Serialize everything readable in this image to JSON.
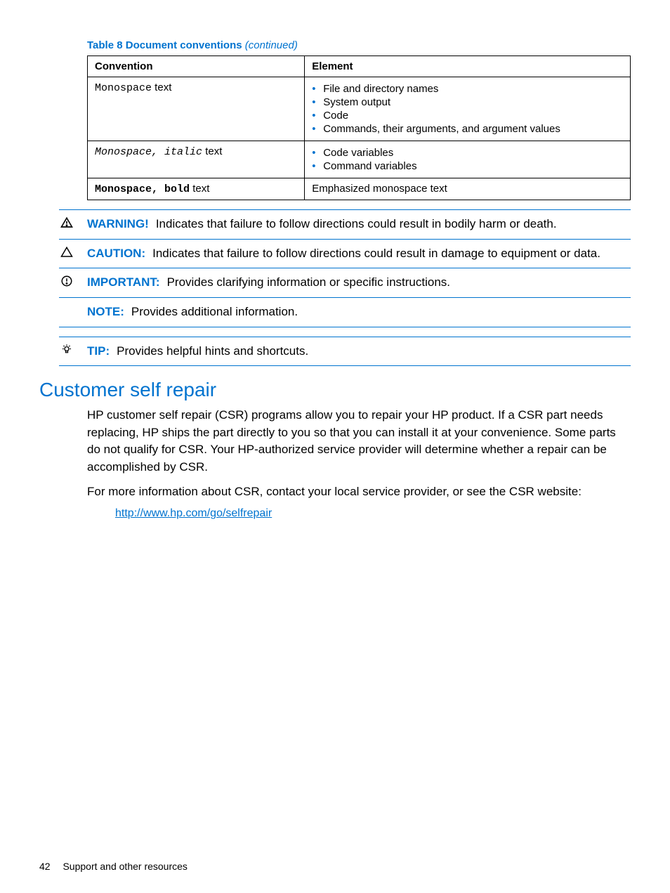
{
  "table": {
    "caption_strong": "Table 8 Document conventions",
    "caption_cont": "(continued)",
    "head_conv": "Convention",
    "head_elem": "Element",
    "rows": [
      {
        "conv_mono": "Monospace",
        "conv_plain": " text",
        "elems": [
          "File and directory names",
          "System output",
          "Code",
          "Commands, their arguments, and argument values"
        ]
      },
      {
        "conv_monoital": "Monospace, italic",
        "conv_plain": " text",
        "elems": [
          "Code variables",
          "Command variables"
        ]
      },
      {
        "conv_monobold": "Monospace, bold",
        "conv_plain": " text",
        "elem_text": "Emphasized monospace text"
      }
    ]
  },
  "admons": {
    "warning": {
      "label": "WARNING!",
      "text": "Indicates that failure to follow directions could result in bodily harm or death."
    },
    "caution": {
      "label": "CAUTION:",
      "text": "Indicates that failure to follow directions could result in damage to equipment or data."
    },
    "important": {
      "label": "IMPORTANT:",
      "text": "Provides clarifying information or specific instructions."
    },
    "note": {
      "label": "NOTE:",
      "text": "Provides additional information."
    },
    "tip": {
      "label": "TIP:",
      "text": "Provides helpful hints and shortcuts."
    }
  },
  "section": {
    "title": "Customer self repair",
    "p1": "HP customer self repair (CSR) programs allow you to repair your HP product. If a CSR part needs replacing, HP ships the part directly to you so that you can install it at your convenience. Some parts do not qualify for CSR. Your HP-authorized service provider will determine whether a repair can be accomplished by CSR.",
    "p2": "For more information about CSR, contact your local service provider, or see the CSR website:",
    "link": "http://www.hp.com/go/selfrepair"
  },
  "footer": {
    "page": "42",
    "chapter": "Support and other resources"
  }
}
